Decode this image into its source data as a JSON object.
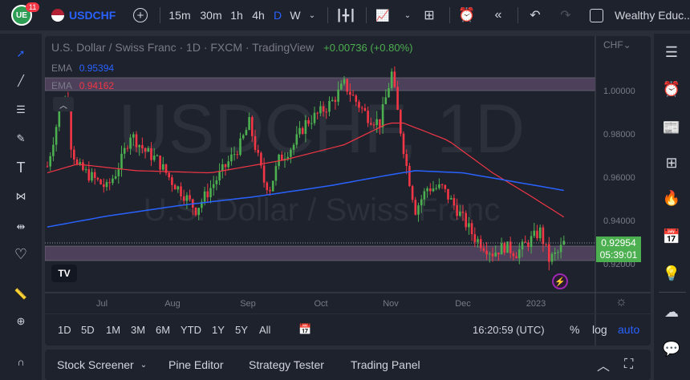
{
  "toolbar": {
    "badge": "11",
    "symbol": "USDCHF",
    "intervals": [
      "15m",
      "30m",
      "1h",
      "4h",
      "D",
      "W"
    ],
    "active_interval": "D",
    "layout_name": "Wealthy Educ..."
  },
  "legend": {
    "title": "U.S. Dollar / Swiss Franc · 1D · FXCM · TradingView",
    "change": "+0.00736 (+0.80%)",
    "ema1_label": "EMA",
    "ema1_value": "0.95394",
    "ema2_label": "EMA",
    "ema2_value": "0.94162"
  },
  "watermark": {
    "big": "USDCHF, 1D",
    "small": "U.S. Dollar / Swiss Franc"
  },
  "price_axis": {
    "currency": "CHF",
    "ticks": [
      "1.00000",
      "0.98000",
      "0.96000",
      "0.94000",
      "0.92000"
    ],
    "last_price": "0.92954",
    "countdown": "05:39:01"
  },
  "time_axis": [
    "Jul",
    "Aug",
    "Sep",
    "Oct",
    "Nov",
    "Dec",
    "2023"
  ],
  "ranges": [
    "1D",
    "5D",
    "1M",
    "3M",
    "6M",
    "YTD",
    "1Y",
    "5Y",
    "All"
  ],
  "clock": "16:20:59 (UTC)",
  "scale_opts": {
    "pct": "%",
    "log": "log",
    "auto": "auto"
  },
  "bottom_tabs": [
    "Stock Screener",
    "Pine Editor",
    "Strategy Tester",
    "Trading Panel"
  ],
  "colors": {
    "up": "#4caf50",
    "down": "#f23645",
    "ema_blue": "#2962ff",
    "ema_red": "#f23645",
    "zone": "#5d4a6b"
  },
  "chart_data": {
    "type": "candlestick",
    "candles": 150,
    "close_anchors": [
      [
        0,
        0.965
      ],
      [
        4,
        0.99
      ],
      [
        7,
        0.998
      ],
      [
        8,
        0.975
      ],
      [
        10,
        0.965
      ],
      [
        15,
        0.96
      ],
      [
        20,
        0.955
      ],
      [
        25,
        0.968
      ],
      [
        23,
        0.962
      ],
      [
        28,
        0.98
      ],
      [
        33,
        0.972
      ],
      [
        37,
        0.968
      ],
      [
        42,
        0.958
      ],
      [
        46,
        0.952
      ],
      [
        50,
        0.945
      ],
      [
        55,
        0.955
      ],
      [
        60,
        0.965
      ],
      [
        65,
        0.975
      ],
      [
        68,
        0.985
      ],
      [
        73,
        0.958
      ],
      [
        75,
        0.955
      ],
      [
        78,
        0.968
      ],
      [
        83,
        0.975
      ],
      [
        87,
        0.985
      ],
      [
        92,
        0.99
      ],
      [
        96,
        0.995
      ],
      [
        100,
        1.003
      ],
      [
        104,
        0.995
      ],
      [
        108,
        0.988
      ],
      [
        112,
        0.985
      ],
      [
        116,
        1.008
      ],
      [
        118,
        0.99
      ],
      [
        121,
        0.965
      ],
      [
        124,
        0.945
      ],
      [
        128,
        0.955
      ],
      [
        133,
        0.955
      ],
      [
        138,
        0.945
      ],
      [
        144,
        0.932
      ],
      [
        150,
        0.925
      ],
      [
        154,
        0.928
      ],
      [
        158,
        0.925
      ],
      [
        162,
        0.93
      ],
      [
        166,
        0.935
      ],
      [
        169,
        0.922
      ],
      [
        172,
        0.925
      ],
      [
        174,
        0.9295
      ]
    ],
    "ema_red": [
      [
        0,
        0.962
      ],
      [
        10,
        0.966
      ],
      [
        30,
        0.963
      ],
      [
        55,
        0.962
      ],
      [
        80,
        0.968
      ],
      [
        100,
        0.975
      ],
      [
        115,
        0.985
      ],
      [
        120,
        0.985
      ],
      [
        135,
        0.977
      ],
      [
        150,
        0.962
      ],
      [
        162,
        0.952
      ],
      [
        174,
        0.9416
      ]
    ],
    "ema_blue": [
      [
        0,
        0.937
      ],
      [
        20,
        0.942
      ],
      [
        45,
        0.947
      ],
      [
        70,
        0.951
      ],
      [
        95,
        0.956
      ],
      [
        115,
        0.961
      ],
      [
        124,
        0.963
      ],
      [
        140,
        0.962
      ],
      [
        174,
        0.9539
      ]
    ],
    "ylim": [
      0.905,
      1.015
    ]
  }
}
